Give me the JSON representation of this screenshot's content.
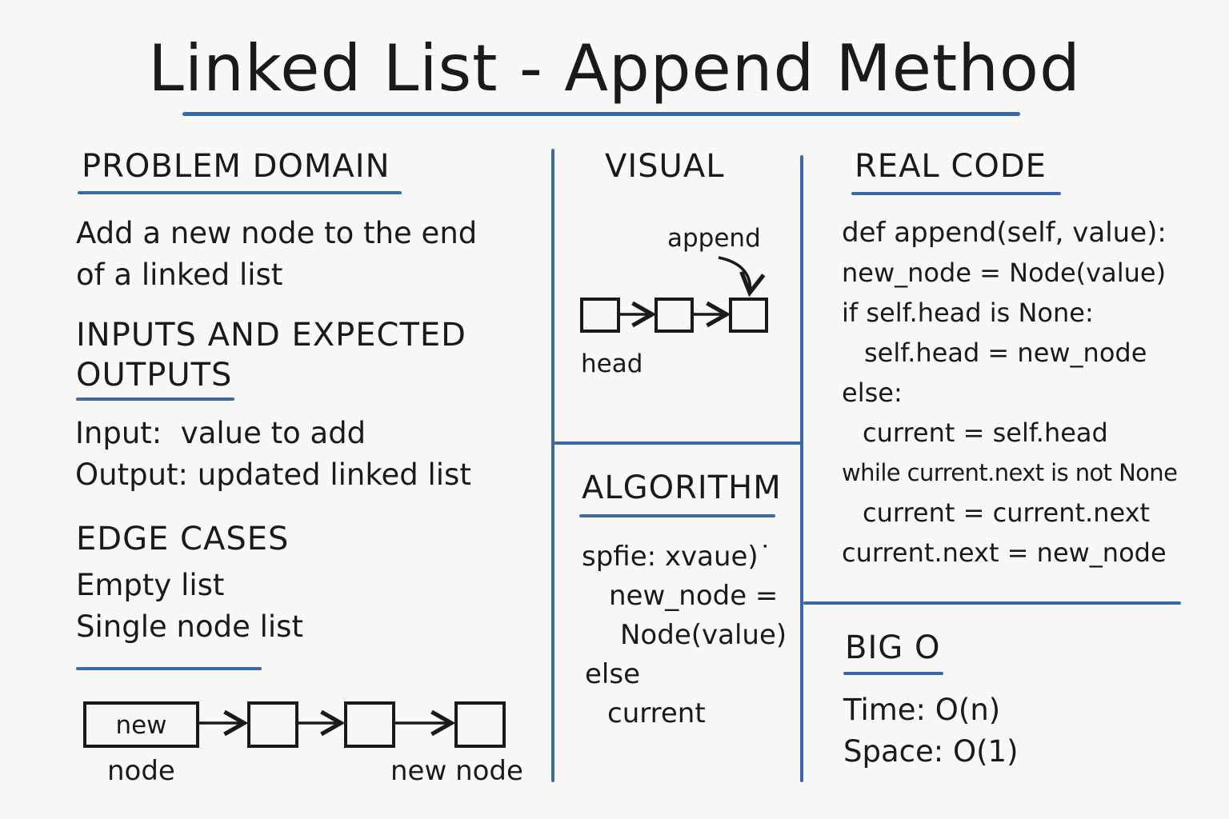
{
  "title": "Linked List - Append Method",
  "problem_domain": {
    "heading": "PROBLEM DOMAIN",
    "lines": [
      "Add a new node to the end",
      "of a linked list"
    ]
  },
  "inputs_outputs": {
    "heading_lines": [
      "INPUTS AND EXPECTED",
      "OUTPUTS"
    ],
    "lines": [
      "Input:  value to add",
      "Output: updated linked list"
    ]
  },
  "edge_cases": {
    "heading": "EDGE CASES",
    "lines": [
      "Empty list",
      "Single node list"
    ]
  },
  "bottom_diagram": {
    "new_box_label": "new",
    "left_label": "node",
    "right_label": "new node"
  },
  "visual": {
    "heading": "VISUAL",
    "append_label": "append",
    "head_label": "head"
  },
  "algorithm": {
    "heading": "ALGORITHM",
    "lines": [
      "spfie: xvaue)˙",
      "new_node =",
      "Node(value)",
      "else",
      "current"
    ]
  },
  "real_code": {
    "heading": "REAL CODE",
    "lines": [
      "def append(self, value):",
      "new_node = Node(value)",
      "if self.head is None:",
      "self.head = new_node",
      "else:",
      "current = self.head",
      "while current.next is not None",
      "current = current.next",
      "current.next = new_node"
    ]
  },
  "big_o": {
    "heading": "BIG O",
    "lines": [
      "Time: O(n)",
      "Space: O(1)"
    ]
  },
  "colors": {
    "rule": "#3a6aa8",
    "ink": "#1a1a1a",
    "background": "#f8f8f6"
  }
}
